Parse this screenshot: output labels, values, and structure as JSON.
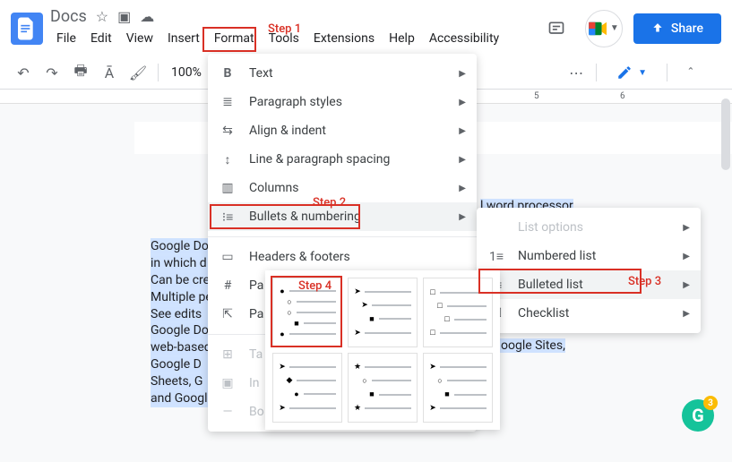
{
  "header": {
    "title": "Docs",
    "menus": [
      "File",
      "Edit",
      "View",
      "Insert",
      "Format",
      "Tools",
      "Extensions",
      "Help",
      "Accessibility"
    ],
    "share_label": "Share"
  },
  "toolbar": {
    "zoom": "100%",
    "more": "⋯"
  },
  "ruler": {
    "m5": "5",
    "m6": "6"
  },
  "document": {
    "lines": [
      "Google Do",
      "in which d",
      "Can be cre",
      "Multiple pe",
      "See edits",
      "Google Do",
      "web-based",
      " Google D",
      "Sheets, G",
      "and Googl"
    ],
    "rt1": "l word processor",
    "rt2": "s, Google Sites,"
  },
  "format_menu": {
    "items": [
      {
        "icon": "B",
        "label": "Text",
        "arrow": true,
        "bold": true
      },
      {
        "icon": "≣",
        "label": "Paragraph styles",
        "arrow": true
      },
      {
        "icon": "⇄",
        "label": "Align & indent",
        "arrow": true
      },
      {
        "icon": "↕≡",
        "label": "Line & paragraph spacing",
        "arrow": true
      },
      {
        "icon": "≡≡",
        "label": "Columns",
        "arrow": true
      },
      {
        "icon": "⋮≡",
        "label": "Bullets & numbering",
        "arrow": true,
        "hover": true
      },
      {
        "sep": true
      },
      {
        "icon": "▭",
        "label": "Headers & footers"
      },
      {
        "icon": "#",
        "label": "Pa",
        "truncated": true
      },
      {
        "icon": "↗",
        "label": "Pa",
        "truncated": true
      },
      {
        "sep": true
      },
      {
        "icon": "☰",
        "label": "Ta",
        "disabled": true,
        "truncated": true
      },
      {
        "icon": "🖼",
        "label": "In",
        "disabled": true,
        "truncated": true
      },
      {
        "icon": "—",
        "label": "Bo",
        "disabled": true,
        "truncated": true
      }
    ]
  },
  "submenu": {
    "items": [
      {
        "label": "List options",
        "arrow": true,
        "disabled": true
      },
      {
        "icon": "1≡",
        "label": "Numbered list",
        "arrow": true
      },
      {
        "icon": "⋮≡",
        "label": "Bulleted list",
        "arrow": true,
        "hover": true
      },
      {
        "icon": "☑≡",
        "label": "Checklist",
        "arrow": true
      }
    ]
  },
  "steps": {
    "s1": "Step 1",
    "s2": "Step 2",
    "s3": "Step 3",
    "s4": "Step 4"
  },
  "grammarly": {
    "letter": "G",
    "badge": "3"
  }
}
